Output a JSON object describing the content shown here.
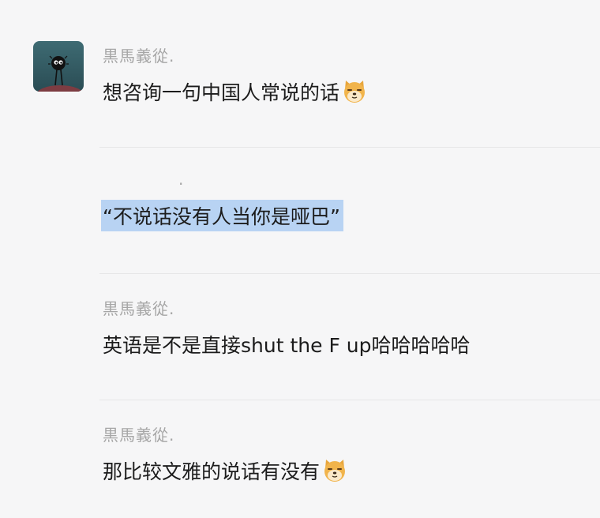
{
  "messages": [
    {
      "sender": "黒馬義從.",
      "text": "想咨询一句中国人常说的话",
      "emoji": "doge-emoji"
    },
    {
      "sender": ".",
      "sender_blurred": true,
      "text": "“不说话没有人当你是哑巴”",
      "highlighted": true
    },
    {
      "sender": "黒馬義從.",
      "text": "英语是不是直接shut the F up哈哈哈哈哈"
    },
    {
      "sender": "黒馬義從.",
      "text": "那比较文雅的说话有没有",
      "emoji": "doge-emoji"
    }
  ],
  "colors": {
    "background": "#f6f6f7",
    "sender": "#a6a6a6",
    "text": "#1c1c1c",
    "highlight": "#b8d3f3",
    "divider": "#e6e6e7"
  }
}
